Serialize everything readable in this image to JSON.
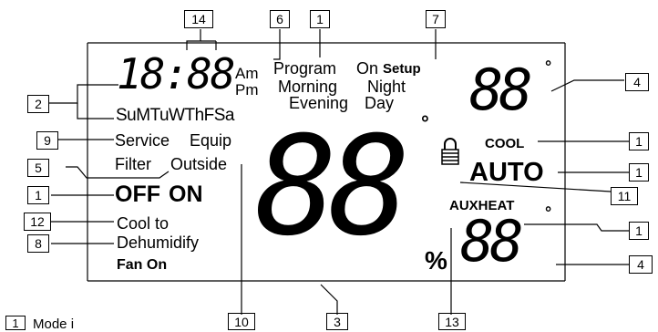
{
  "time": {
    "digits": "18:88",
    "am": "Am",
    "pm": "Pm"
  },
  "days": "SuMTuWThFSa",
  "program": {
    "program": "Program",
    "on": "On",
    "setup": "Setup",
    "morning": "Morning",
    "night": "Night",
    "evening": "Evening",
    "day": "Day"
  },
  "indicators": {
    "service": "Service",
    "equip": "Equip",
    "filter": "Filter",
    "outside": "Outside",
    "off": "OFF",
    "on": "ON",
    "cool_to": "Cool to",
    "dehumidify": "Dehumidify",
    "fan_on": "Fan On"
  },
  "right_panel": {
    "top_digits": "88",
    "degree": "°",
    "cool": "COOL",
    "auto": "AUTO",
    "auxheat": "AUXHEAT",
    "bottom_digits": "88"
  },
  "main": {
    "digits": "88",
    "degree": "°",
    "percent": "%"
  },
  "callouts": [
    {
      "id": "c14",
      "label": "14"
    },
    {
      "id": "c6",
      "label": "6"
    },
    {
      "id": "c1top",
      "label": "1"
    },
    {
      "id": "c7",
      "label": "7"
    },
    {
      "id": "c4top",
      "label": "4"
    },
    {
      "id": "c2",
      "label": "2"
    },
    {
      "id": "c9",
      "label": "9"
    },
    {
      "id": "c5",
      "label": "5"
    },
    {
      "id": "c1off",
      "label": "1"
    },
    {
      "id": "c12",
      "label": "12"
    },
    {
      "id": "c8",
      "label": "8"
    },
    {
      "id": "c1cool",
      "label": "1"
    },
    {
      "id": "c1auto",
      "label": "1"
    },
    {
      "id": "c11",
      "label": "11"
    },
    {
      "id": "c1aux",
      "label": "1"
    },
    {
      "id": "c4bot",
      "label": "4"
    },
    {
      "id": "c10",
      "label": "10"
    },
    {
      "id": "c3",
      "label": "3"
    },
    {
      "id": "c13",
      "label": "13"
    },
    {
      "id": "c1legend",
      "label": "1"
    }
  ],
  "legend": {
    "text": "Mode i"
  }
}
